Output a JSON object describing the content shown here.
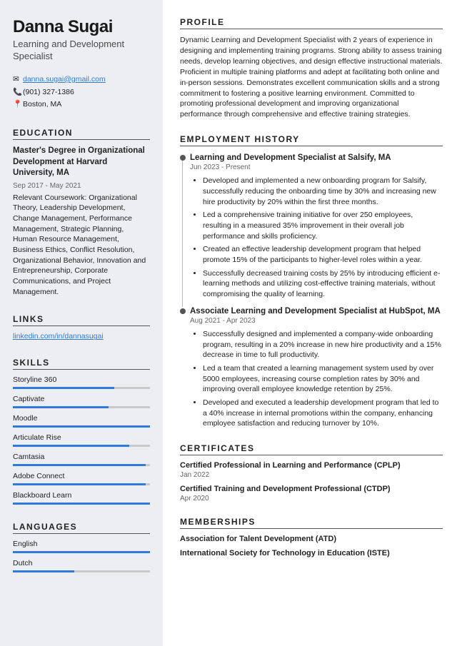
{
  "name": "Danna Sugai",
  "title": "Learning and Development Specialist",
  "contact": {
    "email": "danna.sugai@gmail.com",
    "phone": "(901) 327-1386",
    "location": "Boston, MA"
  },
  "headings": {
    "education": "EDUCATION",
    "links": "LINKS",
    "skills": "SKILLS",
    "languages": "LANGUAGES",
    "profile": "PROFILE",
    "employment": "EMPLOYMENT HISTORY",
    "certificates": "CERTIFICATES",
    "memberships": "MEMBERSHIPS"
  },
  "education": {
    "degree": "Master's Degree in Organizational Development at Harvard University, MA",
    "dates": "Sep 2017 - May 2021",
    "coursework": "Relevant Coursework: Organizational Theory, Leadership Development, Change Management, Performance Management, Strategic Planning, Human Resource Management, Business Ethics, Conflict Resolution, Organizational Behavior, Innovation and Entrepreneurship, Corporate Communications, and Project Management."
  },
  "links": {
    "linkedin": "linkedin.com/in/dannasugai"
  },
  "skills": [
    {
      "label": "Storyline 360",
      "pct": 74
    },
    {
      "label": "Captivate",
      "pct": 70
    },
    {
      "label": "Moodle",
      "pct": 100
    },
    {
      "label": "Articulate Rise",
      "pct": 85
    },
    {
      "label": "Camtasia",
      "pct": 97
    },
    {
      "label": "Adobe Connect",
      "pct": 97
    },
    {
      "label": "Blackboard Learn",
      "pct": 100
    }
  ],
  "languages": [
    {
      "label": "English",
      "pct": 100
    },
    {
      "label": "Dutch",
      "pct": 45
    }
  ],
  "profile": "Dynamic Learning and Development Specialist with 2 years of experience in designing and implementing training programs. Strong ability to assess training needs, develop learning objectives, and design effective instructional materials. Proficient in multiple training platforms and adept at facilitating both online and in-person sessions. Demonstrates excellent communication skills and a strong commitment to fostering a positive learning environment. Committed to promoting professional development and improving organizational performance through comprehensive and effective training strategies.",
  "jobs": [
    {
      "title": "Learning and Development Specialist at Salsify, MA",
      "dates": "Jun 2023 - Present",
      "bullets": [
        "Developed and implemented a new onboarding program for Salsify, successfully reducing the onboarding time by 30% and increasing new hire productivity by 20% within the first three months.",
        "Led a comprehensive training initiative for over 250 employees, resulting in a measured 35% improvement in their overall job performance and skills proficiency.",
        "Created an effective leadership development program that helped promote 15% of the participants to higher-level roles within a year.",
        "Successfully decreased training costs by 25% by introducing efficient e-learning methods and utilizing cost-effective training materials, without compromising the quality of learning."
      ]
    },
    {
      "title": "Associate Learning and Development Specialist at HubSpot, MA",
      "dates": "Aug 2021 - Apr 2023",
      "bullets": [
        "Successfully designed and implemented a company-wide onboarding program, resulting in a 20% increase in new hire productivity and a 15% decrease in time to full productivity.",
        "Led a team that created a learning management system used by over 5000 employees, increasing course completion rates by 30% and improving overall employee knowledge retention by 25%.",
        "Developed and executed a leadership development program that led to a 40% increase in internal promotions within the company, enhancing employee satisfaction and reducing turnover by 10%."
      ]
    }
  ],
  "certificates": [
    {
      "title": "Certified Professional in Learning and Performance (CPLP)",
      "date": "Jan 2022"
    },
    {
      "title": "Certified Training and Development Professional (CTDP)",
      "date": "Apr 2020"
    }
  ],
  "memberships": [
    "Association for Talent Development (ATD)",
    "International Society for Technology in Education (ISTE)"
  ]
}
